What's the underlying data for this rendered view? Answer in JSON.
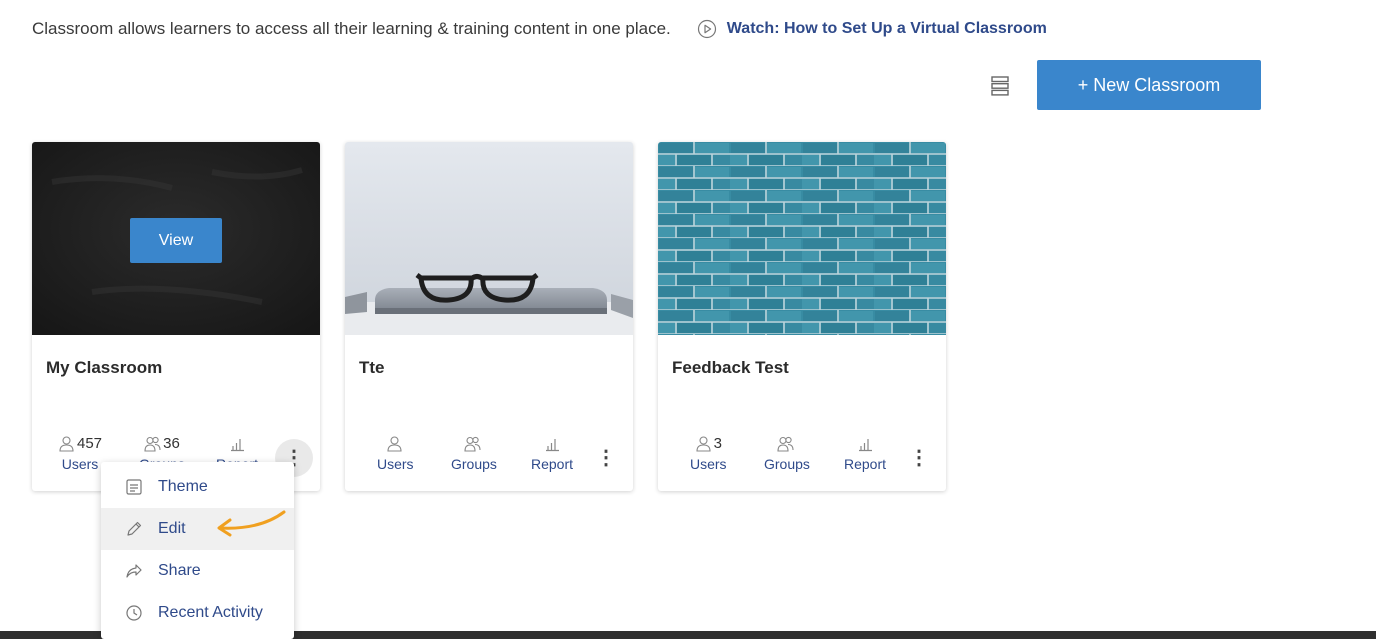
{
  "intro": {
    "text": "Classroom allows learners to access all their learning & training content in one place.",
    "watch_link": "Watch: How to Set Up a Virtual Classroom"
  },
  "toolbar": {
    "list_view_icon": "list-view-icon",
    "new_button": "+ New Classroom"
  },
  "colors": {
    "accent": "#3a86cc",
    "link": "#2f4a8a",
    "annotation_arrow": "#f0a020"
  },
  "cards": [
    {
      "title": "My Classroom",
      "image": "dark-chalkboard",
      "view_button": "View",
      "stats": {
        "users_count": "457",
        "users_label": "Users",
        "groups_count": "36",
        "groups_label": "Groups",
        "report_label": "Report"
      }
    },
    {
      "title": "Tte",
      "image": "glasses-on-laptop",
      "stats": {
        "users_count": "",
        "users_label": "Users",
        "groups_count": "",
        "groups_label": "Groups",
        "report_label": "Report"
      }
    },
    {
      "title": "Feedback Test",
      "image": "blue-brick-wall",
      "stats": {
        "users_count": "3",
        "users_label": "Users",
        "groups_count": "",
        "groups_label": "Groups",
        "report_label": "Report"
      }
    }
  ],
  "context_menu": {
    "items": [
      {
        "label": "Theme",
        "icon": "theme-icon"
      },
      {
        "label": "Edit",
        "icon": "pencil-icon"
      },
      {
        "label": "Share",
        "icon": "share-icon"
      },
      {
        "label": "Recent Activity",
        "icon": "clock-icon"
      }
    ]
  }
}
